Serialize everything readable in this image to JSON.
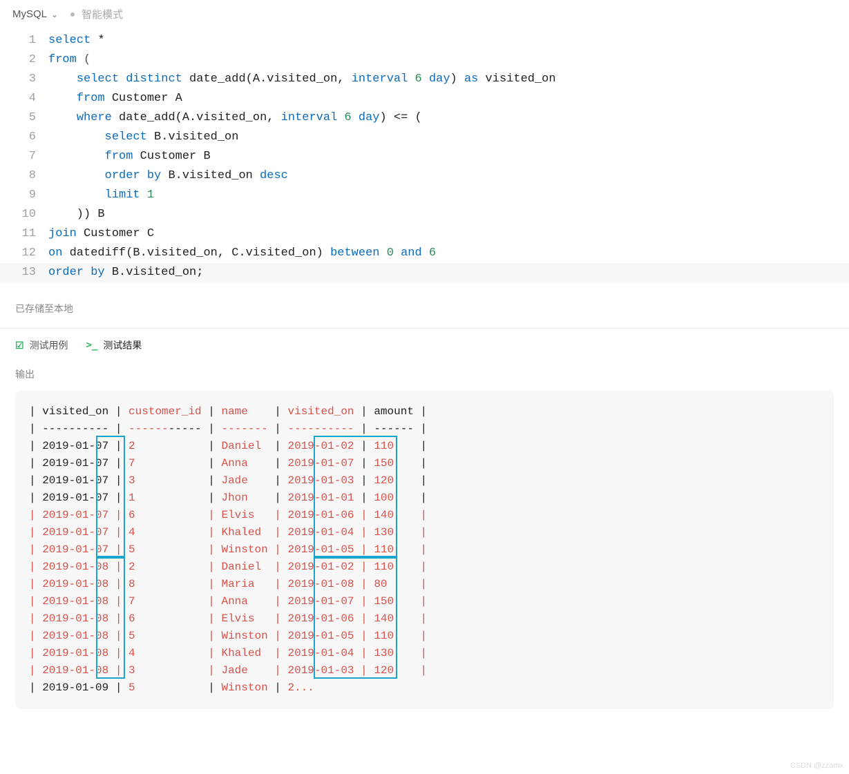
{
  "topbar": {
    "db": "MySQL",
    "mode": "智能模式"
  },
  "save_hint": "已存储至本地",
  "tabs": {
    "testcases": "测试用例",
    "results": "测试结果"
  },
  "output_label": "输出",
  "code_lines": [
    [
      {
        "t": "select",
        "c": "kw"
      },
      {
        "t": " *",
        "c": "ident"
      }
    ],
    [
      {
        "t": "from",
        "c": "kw"
      },
      {
        "t": " (",
        "c": "punc"
      }
    ],
    [
      {
        "t": "    ",
        "c": "ident"
      },
      {
        "t": "select",
        "c": "kw"
      },
      {
        "t": " ",
        "c": "ident"
      },
      {
        "t": "distinct",
        "c": "kw"
      },
      {
        "t": " date_add(A.visited_on, ",
        "c": "ident"
      },
      {
        "t": "interval",
        "c": "kw"
      },
      {
        "t": " ",
        "c": "ident"
      },
      {
        "t": "6",
        "c": "num"
      },
      {
        "t": " ",
        "c": "ident"
      },
      {
        "t": "day",
        "c": "kw"
      },
      {
        "t": ") ",
        "c": "ident"
      },
      {
        "t": "as",
        "c": "kw"
      },
      {
        "t": " visited_on",
        "c": "ident"
      }
    ],
    [
      {
        "t": "    ",
        "c": "ident"
      },
      {
        "t": "from",
        "c": "kw"
      },
      {
        "t": " Customer A",
        "c": "ident"
      }
    ],
    [
      {
        "t": "    ",
        "c": "ident"
      },
      {
        "t": "where",
        "c": "kw"
      },
      {
        "t": " date_add(A.visited_on, ",
        "c": "ident"
      },
      {
        "t": "interval",
        "c": "kw"
      },
      {
        "t": " ",
        "c": "ident"
      },
      {
        "t": "6",
        "c": "num"
      },
      {
        "t": " ",
        "c": "ident"
      },
      {
        "t": "day",
        "c": "kw"
      },
      {
        "t": ") <= (",
        "c": "ident"
      }
    ],
    [
      {
        "t": "        ",
        "c": "ident"
      },
      {
        "t": "select",
        "c": "kw"
      },
      {
        "t": " B.visited_on",
        "c": "ident"
      }
    ],
    [
      {
        "t": "        ",
        "c": "ident"
      },
      {
        "t": "from",
        "c": "kw"
      },
      {
        "t": " Customer B",
        "c": "ident"
      }
    ],
    [
      {
        "t": "        ",
        "c": "ident"
      },
      {
        "t": "order",
        "c": "kw"
      },
      {
        "t": " ",
        "c": "ident"
      },
      {
        "t": "by",
        "c": "kw"
      },
      {
        "t": " B.visited_on ",
        "c": "ident"
      },
      {
        "t": "desc",
        "c": "kw"
      }
    ],
    [
      {
        "t": "        ",
        "c": "ident"
      },
      {
        "t": "limit",
        "c": "kw"
      },
      {
        "t": " ",
        "c": "ident"
      },
      {
        "t": "1",
        "c": "num"
      }
    ],
    [
      {
        "t": "    )) B",
        "c": "ident"
      }
    ],
    [
      {
        "t": "join",
        "c": "kw"
      },
      {
        "t": " Customer C",
        "c": "ident"
      }
    ],
    [
      {
        "t": "on",
        "c": "kw"
      },
      {
        "t": " datediff(B.visited_on, C.visited_on) ",
        "c": "ident"
      },
      {
        "t": "between",
        "c": "kw"
      },
      {
        "t": " ",
        "c": "ident"
      },
      {
        "t": "0",
        "c": "num"
      },
      {
        "t": " ",
        "c": "ident"
      },
      {
        "t": "and",
        "c": "kw"
      },
      {
        "t": " ",
        "c": "ident"
      },
      {
        "t": "6",
        "c": "num"
      }
    ],
    [
      {
        "t": "order",
        "c": "kw"
      },
      {
        "t": " ",
        "c": "ident"
      },
      {
        "t": "by",
        "c": "kw"
      },
      {
        "t": " B.visited_on;",
        "c": "ident"
      }
    ]
  ],
  "output_header": {
    "cols": [
      "visited_on",
      "customer_id",
      "name",
      "visited_on",
      "amount"
    ]
  },
  "output_rows": [
    {
      "c": "black",
      "visited_on": "2019-01-07",
      "customer_id": "2",
      "name": "Daniel ",
      "visited_on2": "2019-01-02",
      "amount": "110"
    },
    {
      "c": "black",
      "visited_on": "2019-01-07",
      "customer_id": "7",
      "name": "Anna   ",
      "visited_on2": "2019-01-07",
      "amount": "150"
    },
    {
      "c": "black",
      "visited_on": "2019-01-07",
      "customer_id": "3",
      "name": "Jade   ",
      "visited_on2": "2019-01-03",
      "amount": "120"
    },
    {
      "c": "black",
      "visited_on": "2019-01-07",
      "customer_id": "1",
      "name": "Jhon   ",
      "visited_on2": "2019-01-01",
      "amount": "100"
    },
    {
      "c": "red",
      "visited_on": "2019-01-07",
      "customer_id": "6",
      "name": "Elvis  ",
      "visited_on2": "2019-01-06",
      "amount": "140"
    },
    {
      "c": "red",
      "visited_on": "2019-01-07",
      "customer_id": "4",
      "name": "Khaled ",
      "visited_on2": "2019-01-04",
      "amount": "130"
    },
    {
      "c": "red",
      "visited_on": "2019-01-07",
      "customer_id": "5",
      "name": "Winston",
      "visited_on2": "2019-01-05",
      "amount": "110"
    },
    {
      "c": "red",
      "visited_on": "2019-01-08",
      "customer_id": "2",
      "name": "Daniel ",
      "visited_on2": "2019-01-02",
      "amount": "110"
    },
    {
      "c": "red",
      "visited_on": "2019-01-08",
      "customer_id": "8",
      "name": "Maria  ",
      "visited_on2": "2019-01-08",
      "amount": "80 "
    },
    {
      "c": "red",
      "visited_on": "2019-01-08",
      "customer_id": "7",
      "name": "Anna   ",
      "visited_on2": "2019-01-07",
      "amount": "150"
    },
    {
      "c": "red",
      "visited_on": "2019-01-08",
      "customer_id": "6",
      "name": "Elvis  ",
      "visited_on2": "2019-01-06",
      "amount": "140"
    },
    {
      "c": "red",
      "visited_on": "2019-01-08",
      "customer_id": "5",
      "name": "Winston",
      "visited_on2": "2019-01-05",
      "amount": "110"
    },
    {
      "c": "red",
      "visited_on": "2019-01-08",
      "customer_id": "4",
      "name": "Khaled ",
      "visited_on2": "2019-01-04",
      "amount": "130"
    },
    {
      "c": "red",
      "visited_on": "2019-01-08",
      "customer_id": "3",
      "name": "Jade   ",
      "visited_on2": "2019-01-03",
      "amount": "120"
    }
  ],
  "output_truncated": {
    "visited_on": "2019-01-09",
    "customer_id": "5",
    "name": "Winston",
    "rest": "2..."
  },
  "watermark": "CSDN @zzamx"
}
